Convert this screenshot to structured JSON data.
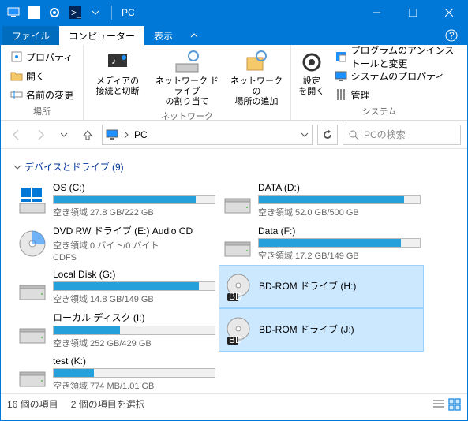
{
  "titlebar": {
    "title": "PC"
  },
  "tabs": {
    "file": "ファイル",
    "computer": "コンピューター",
    "view": "表示"
  },
  "ribbon": {
    "place": {
      "label": "場所",
      "properties": "プロパティ",
      "open": "開く",
      "rename": "名前の変更"
    },
    "network": {
      "label": "ネットワーク",
      "media": "メディアの\n接続と切断",
      "map": "ネットワーク ドライブ\nの割り当て",
      "add": "ネットワークの\n場所の追加"
    },
    "system": {
      "label": "システム",
      "settings": "設定\nを開く",
      "uninstall": "プログラムのアンインストールと変更",
      "props": "システムのプロパティ",
      "manage": "管理"
    }
  },
  "nav": {
    "path": "PC",
    "search_placeholder": "PCの検索"
  },
  "group": {
    "header": "デバイスとドライブ",
    "count": "(9)"
  },
  "drives": [
    {
      "name": "OS (C:)",
      "free": "空き領域 27.8 GB/222 GB",
      "fill": 88,
      "type": "hdd-win",
      "selected": false
    },
    {
      "name": "DATA (D:)",
      "free": "空き領域 52.0 GB/500 GB",
      "fill": 90,
      "type": "hdd",
      "selected": false
    },
    {
      "name": "DVD RW ドライブ (E:) Audio CD",
      "free": "空き領域 0 バイト/0 バイト",
      "sub": "CDFS",
      "type": "dvd",
      "selected": false
    },
    {
      "name": "Data (F:)",
      "free": "空き領域 17.2 GB/149 GB",
      "fill": 88,
      "type": "hdd",
      "selected": false
    },
    {
      "name": "Local Disk (G:)",
      "free": "空き領域 14.8 GB/149 GB",
      "fill": 90,
      "type": "hdd",
      "selected": false
    },
    {
      "name": "BD-ROM ドライブ (H:)",
      "type": "bd",
      "selected": true
    },
    {
      "name": "ローカル ディスク (I:)",
      "free": "空き領域 252 GB/429 GB",
      "fill": 41,
      "type": "hdd",
      "selected": false
    },
    {
      "name": "BD-ROM ドライブ (J:)",
      "type": "bd",
      "selected": true
    },
    {
      "name": "test (K:)",
      "free": "空き領域 774 MB/1.01 GB",
      "fill": 25,
      "type": "hdd",
      "selected": false
    }
  ],
  "status": {
    "count": "16 個の項目",
    "selected": "2 個の項目を選択"
  }
}
